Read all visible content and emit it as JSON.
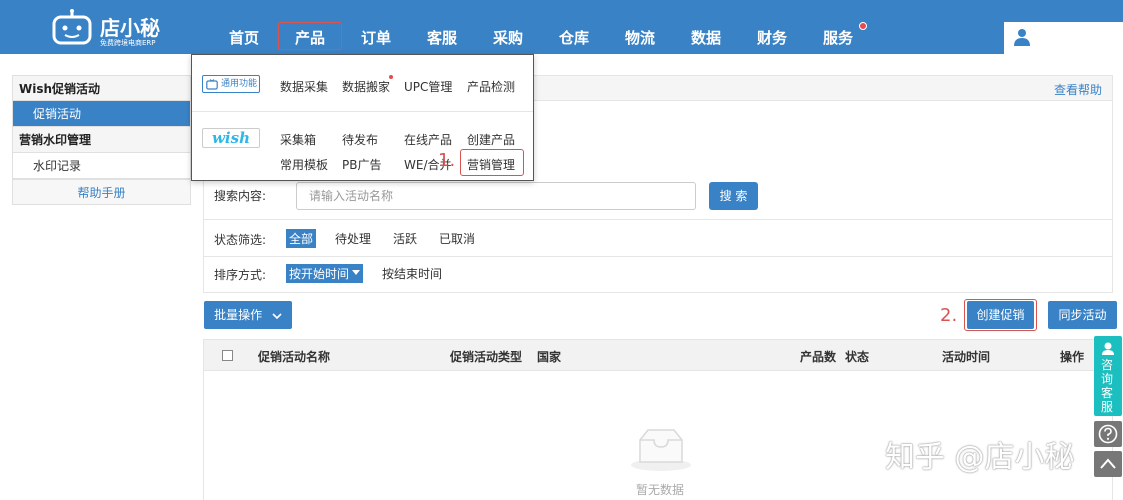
{
  "brand": {
    "name": "店小秘",
    "tagline": "免费跨境电商ERP"
  },
  "nav": {
    "items": [
      "首页",
      "产品",
      "订单",
      "客服",
      "采购",
      "仓库",
      "物流",
      "数据",
      "财务",
      "服务"
    ]
  },
  "sidebar": {
    "groups": [
      {
        "title": "Wish促销活动",
        "items": [
          "促销活动"
        ]
      },
      {
        "title": "营销水印管理",
        "items": [
          "水印记录"
        ]
      }
    ],
    "help": "帮助手册"
  },
  "main": {
    "help_link": "查看帮助",
    "search": {
      "label": "搜索内容:",
      "placeholder": "请输入活动名称",
      "button": "搜 索"
    },
    "status": {
      "label": "状态筛选:",
      "options": [
        "全部",
        "待处理",
        "活跃",
        "已取消"
      ]
    },
    "sort": {
      "label": "排序方式:",
      "options": [
        "按开始时间",
        "按结束时间"
      ]
    },
    "batch": "批量操作",
    "step2": "2.",
    "create": "创建促销",
    "sync": "同步活动",
    "table": {
      "columns": [
        "促销活动名称",
        "促销活动类型",
        "国家",
        "产品数",
        "状态",
        "活动时间",
        "操作"
      ],
      "empty": "暂无数据"
    }
  },
  "dropdown": {
    "general_tag": "通用功能",
    "general": [
      "数据采集",
      "数据搬家",
      "UPC管理",
      "产品检测"
    ],
    "wish_tag": "wish",
    "wish_row1": [
      "采集箱",
      "待发布",
      "在线产品",
      "创建产品"
    ],
    "wish_row2": [
      "常用模板",
      "PB广告",
      "WE/合并",
      "营销管理"
    ],
    "step1": "1."
  },
  "float": {
    "consult": "咨询客服"
  },
  "watermark": "知乎 @店小秘",
  "colors": {
    "primary": "#3a82c6",
    "highlight": "#d9534f",
    "teal": "#1bbfbf"
  }
}
